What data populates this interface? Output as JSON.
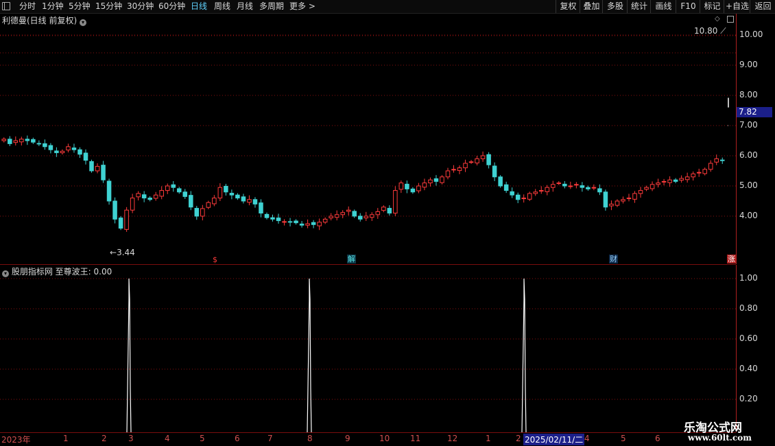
{
  "toolbar": {
    "left_items": [
      "分时",
      "1分钟",
      "5分钟",
      "15分钟",
      "30分钟",
      "60分钟",
      "日线",
      "周线",
      "月线",
      "多周期",
      "更多 >"
    ],
    "active_item": "日线",
    "right_items": [
      "复权",
      "叠加",
      "多股",
      "统计",
      "画线",
      "F10",
      "标记",
      "+自选",
      "返回"
    ]
  },
  "main_panel": {
    "title": "利德曼(日线 前复权)",
    "high_label": "10.80",
    "low_label": "3.44",
    "current_price": "7.82",
    "y_ticks": [
      "10.00",
      "9.00",
      "8.00",
      "7.00",
      "6.00",
      "5.00",
      "4.00"
    ],
    "markers": [
      {
        "text": "$",
        "color": "#ff3b3b",
        "bg": "transparent"
      },
      {
        "text": "解",
        "color": "#55e0e0",
        "bg": "#0e3a4a"
      },
      {
        "text": "财",
        "color": "#9ad4ff",
        "bg": "#0e2a4a"
      },
      {
        "text": "涨",
        "color": "#ffffff",
        "bg": "#b02020"
      }
    ]
  },
  "indicator_panel": {
    "title": "股朋指标网 至尊波王: 0.00",
    "y_ticks": [
      "1.00",
      "0.80",
      "0.60",
      "0.40",
      "0.20"
    ]
  },
  "x_axis": {
    "labels": [
      "2023年",
      "1",
      "2",
      "3",
      "4",
      "5",
      "6",
      "7",
      "8",
      "9",
      "10",
      "11",
      "12",
      "1",
      "2",
      "2025/02/11/二",
      "4",
      "5",
      "6"
    ]
  },
  "watermark": {
    "line1": "乐淘公式网",
    "line2": "www.60lt.com"
  },
  "colors": {
    "up": "#ff3b3b",
    "down": "#3fd2d2",
    "grid": "#8a1010",
    "axis": "#b02020",
    "signal": "#ffffff"
  },
  "chart_data": {
    "type": "candlestick",
    "title": "利德曼(日线 前复权)",
    "y_range": [
      3.2,
      11.2
    ],
    "closes": [
      6.55,
      6.4,
      6.5,
      6.55,
      6.5,
      6.45,
      6.4,
      6.3,
      6.2,
      6.1,
      6.15,
      6.3,
      6.2,
      6.05,
      5.85,
      5.5,
      5.65,
      5.2,
      4.5,
      3.9,
      3.6,
      4.2,
      4.6,
      4.75,
      4.6,
      4.55,
      4.7,
      4.85,
      5.0,
      4.95,
      4.8,
      4.65,
      4.3,
      4.0,
      4.25,
      4.45,
      4.6,
      4.95,
      4.8,
      4.7,
      4.6,
      4.5,
      4.55,
      4.4,
      4.1,
      3.95,
      3.9,
      3.85,
      3.82,
      3.8,
      3.78,
      3.7,
      3.75,
      3.72,
      3.8,
      3.9,
      4.0,
      4.05,
      4.12,
      4.2,
      4.0,
      3.9,
      4.0,
      4.05,
      4.15,
      4.3,
      4.1,
      4.85,
      5.1,
      4.9,
      4.8,
      5.0,
      5.1,
      5.2,
      5.15,
      5.3,
      5.5,
      5.55,
      5.6,
      5.75,
      5.8,
      5.9,
      6.0,
      5.7,
      5.3,
      5.0,
      4.85,
      4.7,
      4.55,
      4.6,
      4.75,
      4.8,
      4.85,
      4.95,
      5.05,
      5.1,
      5.0,
      5.0,
      5.05,
      4.95,
      4.9,
      4.95,
      4.8,
      4.3,
      4.4,
      4.5,
      4.55,
      4.6,
      4.75,
      4.85,
      4.95,
      5.05,
      5.1,
      5.15,
      5.2,
      5.15,
      5.25,
      5.3,
      5.4,
      5.45,
      5.55,
      5.75,
      5.9,
      5.85
    ],
    "last_price": 7.82,
    "indicator": {
      "name": "至尊波王",
      "value": 0.0,
      "signal_bars": [
        46,
        113,
        192
      ]
    }
  }
}
